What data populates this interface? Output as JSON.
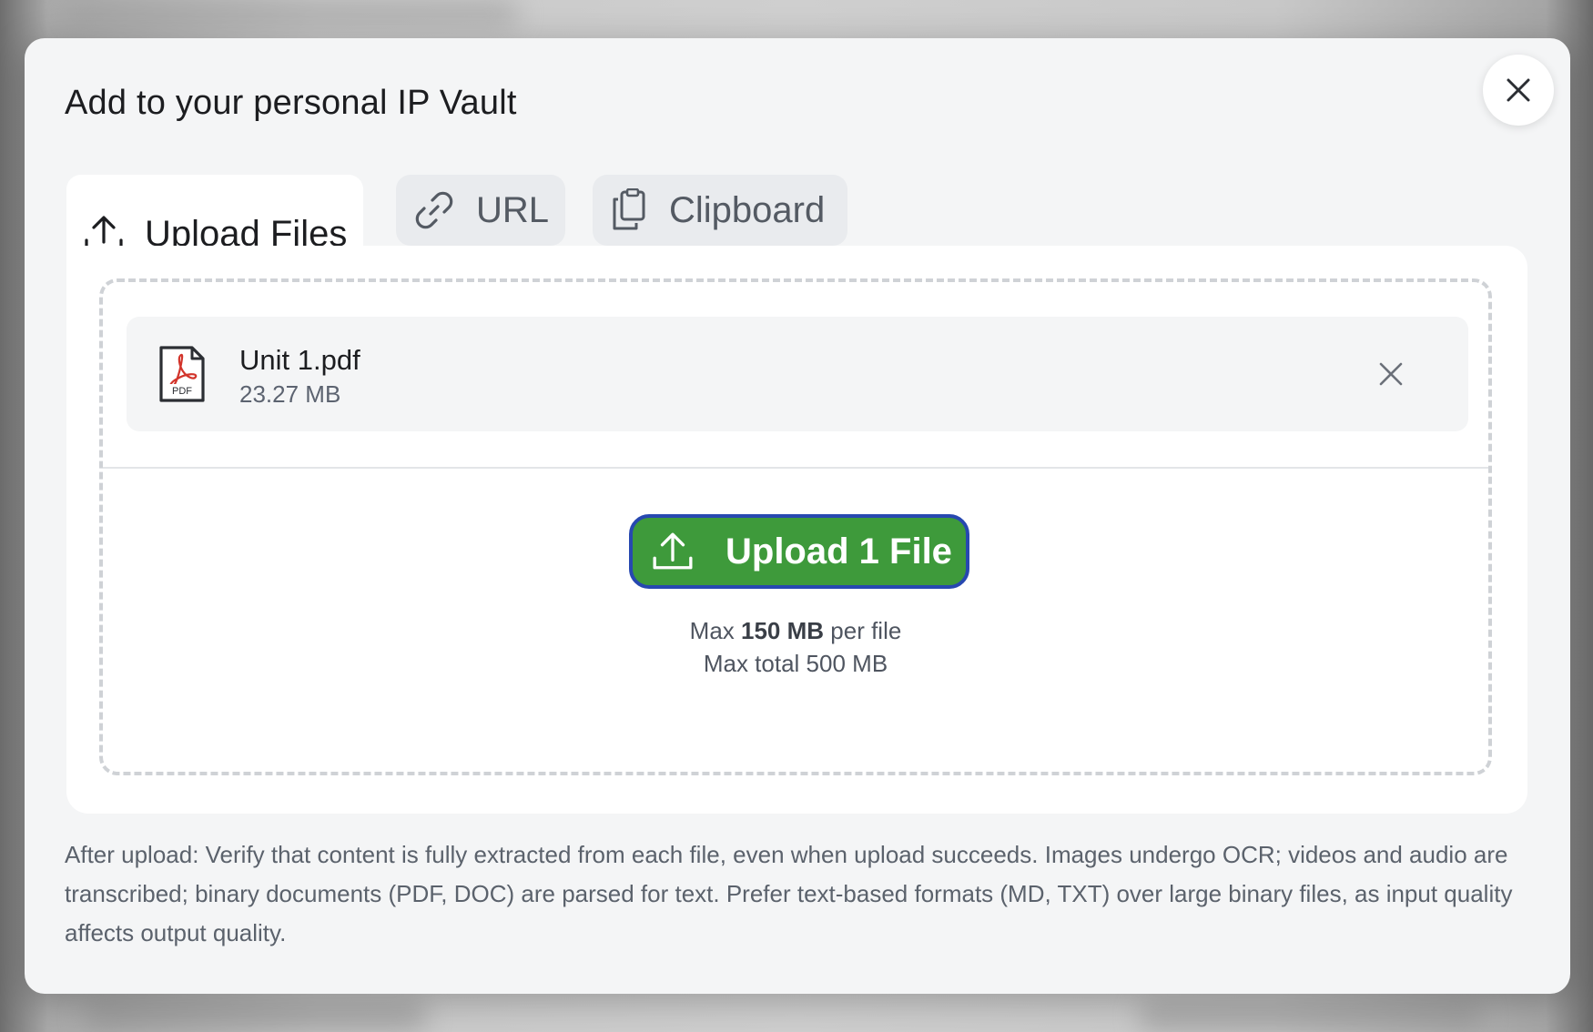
{
  "dialog": {
    "title": "Add to your personal IP Vault",
    "close_icon": "close-icon"
  },
  "tabs": [
    {
      "label": "Upload Files",
      "icon": "upload-icon",
      "active": true
    },
    {
      "label": "URL",
      "icon": "link-icon",
      "active": false
    },
    {
      "label": "Clipboard",
      "icon": "clipboard-icon",
      "active": false
    }
  ],
  "file_list": [
    {
      "name": "Unit 1.pdf",
      "size": "23.27 MB",
      "icon": "pdf-file-icon",
      "remove_icon": "close-icon"
    }
  ],
  "upload_button": {
    "label": "Upload 1 File",
    "icon": "upload-icon",
    "color": "#3e9a3b",
    "border_color": "#2748b0"
  },
  "limits": {
    "per_file_prefix": "Max ",
    "per_file_value": "150 MB",
    "per_file_suffix": " per file",
    "total": "Max total 500 MB"
  },
  "note": "After upload: Verify that content is fully extracted from each file, even when upload succeeds. Images undergo OCR; videos and audio are transcribed; binary documents (PDF, DOC) are parsed for text. Prefer text-based formats (MD, TXT) over large binary files, as input quality affects output quality."
}
